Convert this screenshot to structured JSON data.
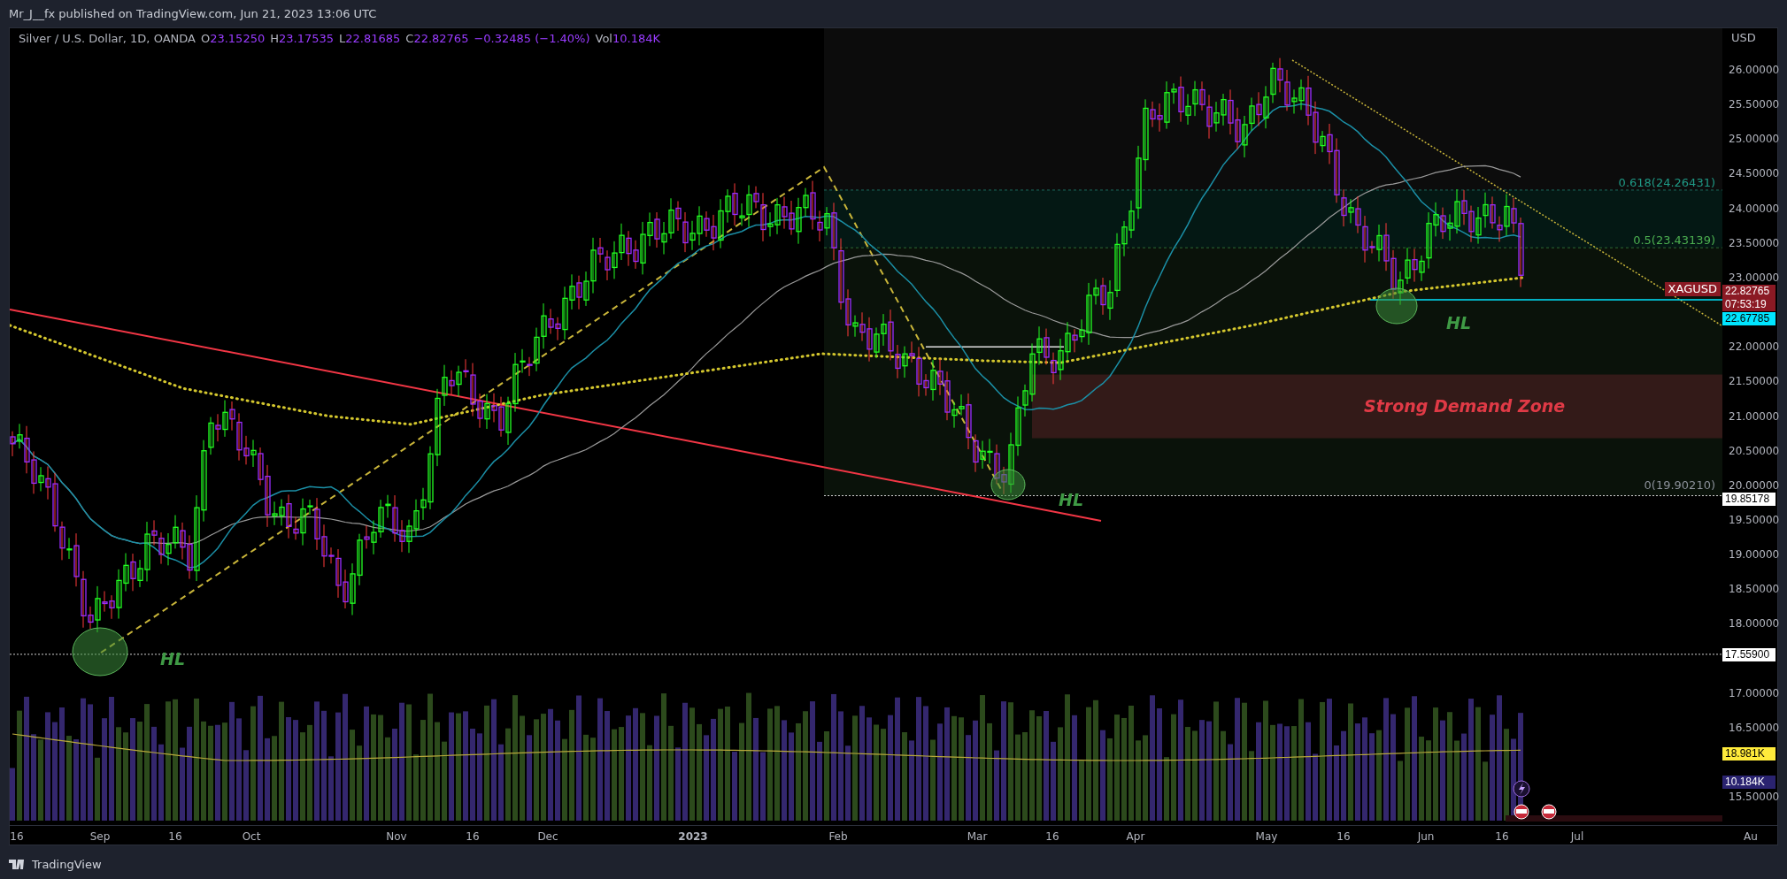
{
  "header": {
    "text": "Mr_J__fx published on TradingView.com, Jun 21, 2023 13:06 UTC"
  },
  "legend": {
    "title": "Silver / U.S. Dollar, 1D, OANDA",
    "values": [
      {
        "label": "O",
        "value": "23.15250"
      },
      {
        "label": "H",
        "value": "23.17535"
      },
      {
        "label": "L",
        "value": "22.81685"
      },
      {
        "label": "C",
        "value": "22.82765"
      }
    ],
    "change": "−0.32485 (−1.40%)",
    "volume": {
      "label": "Vol",
      "value": "10.184K"
    }
  },
  "annotations": {
    "fib_levels": [
      "0.618(24.26431)",
      "0.5(23.43139)",
      "0(19.90210)"
    ],
    "zone": "Strong Demand Zone",
    "hl_labels": [
      "HL",
      "HL",
      "HL"
    ]
  },
  "price_axis": {
    "currency": "USD",
    "ticks": [
      "26.00000",
      "25.50000",
      "25.00000",
      "24.50000",
      "24.00000",
      "23.50000",
      "23.00000",
      "22.00000",
      "21.50000",
      "21.00000",
      "20.50000",
      "20.00000",
      "19.50000",
      "19.00000",
      "18.50000",
      "18.00000",
      "17.00000",
      "16.50000",
      "15.50000"
    ],
    "markers": [
      {
        "kind": "last",
        "symbol": "XAGUSD",
        "value": "22.82765",
        "countdown": "07:53:19"
      },
      {
        "kind": "line",
        "value": "22.67785"
      },
      {
        "kind": "level",
        "value": "19.85178"
      },
      {
        "kind": "level",
        "value": "17.55900"
      },
      {
        "kind": "volume_ma",
        "value": "18.981K"
      },
      {
        "kind": "volume",
        "value": "10.184K"
      }
    ]
  },
  "time_axis": [
    {
      "text": "16",
      "bold": false
    },
    {
      "text": "Sep",
      "bold": false
    },
    {
      "text": "16",
      "bold": false
    },
    {
      "text": "Oct",
      "bold": false
    },
    {
      "text": "Nov",
      "bold": false
    },
    {
      "text": "16",
      "bold": false
    },
    {
      "text": "Dec",
      "bold": false
    },
    {
      "text": "2023",
      "bold": true
    },
    {
      "text": "Feb",
      "bold": false
    },
    {
      "text": "Mar",
      "bold": false
    },
    {
      "text": "16",
      "bold": false
    },
    {
      "text": "Apr",
      "bold": false
    },
    {
      "text": "May",
      "bold": false
    },
    {
      "text": "16",
      "bold": false
    },
    {
      "text": "Jun",
      "bold": false
    },
    {
      "text": "16",
      "bold": false
    },
    {
      "text": "Jul",
      "bold": false
    },
    {
      "text": "Au",
      "bold": false
    }
  ],
  "footer": {
    "brand": "TradingView"
  }
}
